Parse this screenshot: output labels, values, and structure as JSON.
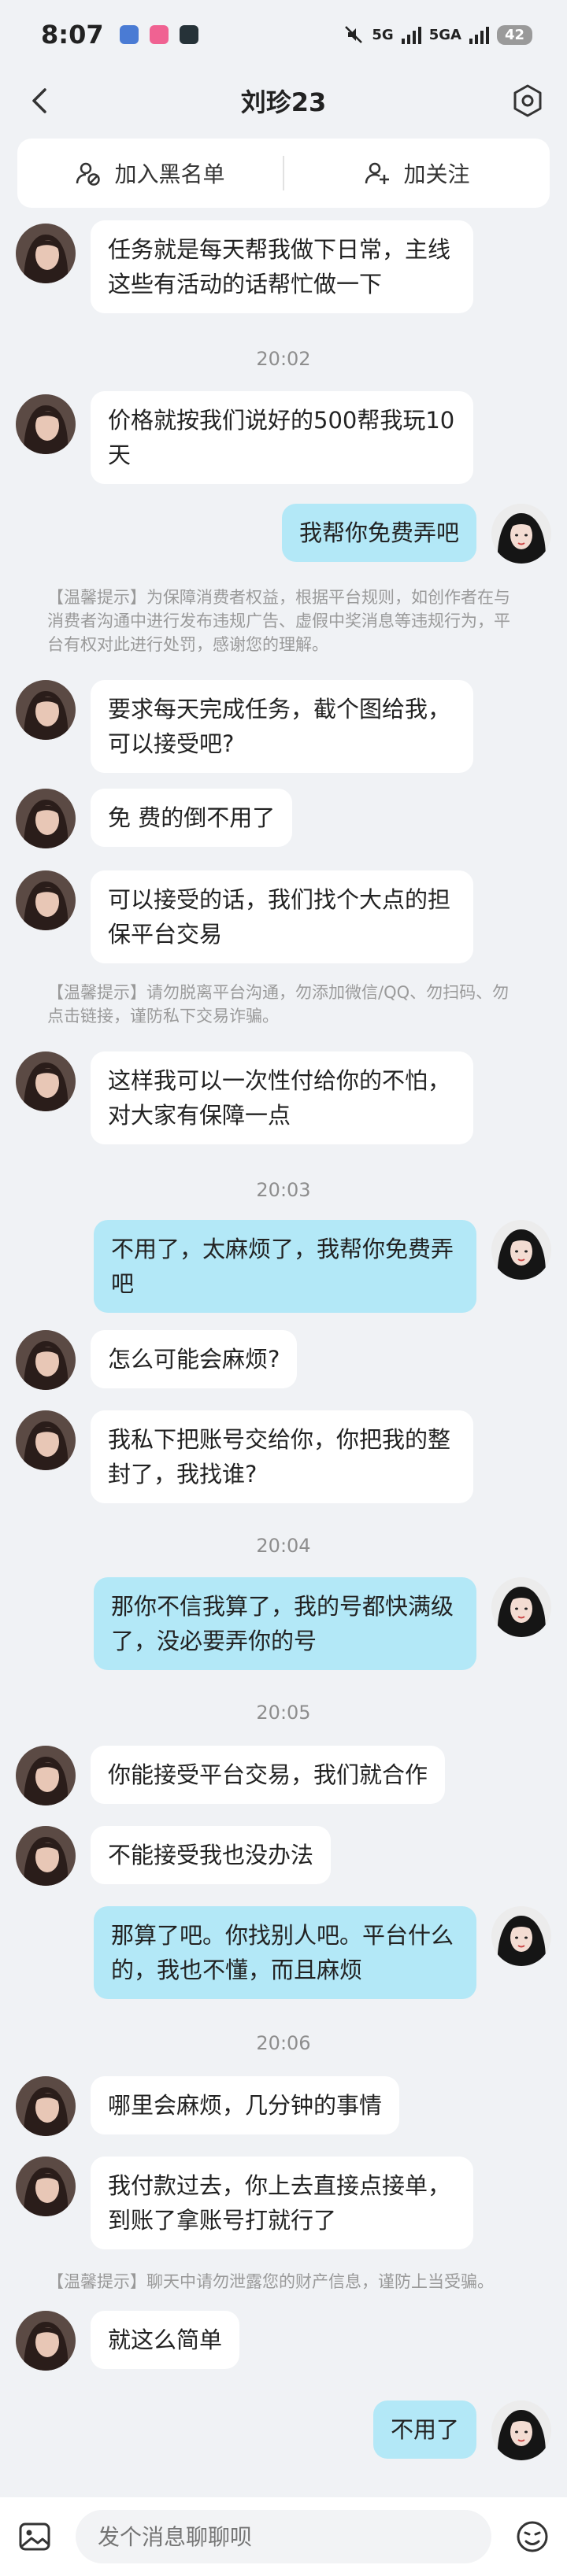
{
  "status": {
    "time": "8:07",
    "network": "5G",
    "network2": "5GA",
    "battery": "42"
  },
  "header": {
    "title": "刘珍23"
  },
  "actions": {
    "blacklist": "加入黑名单",
    "follow": "加关注"
  },
  "messages": [
    {
      "side": "her",
      "text": "任务就是每天帮我做下日常，主线这些有活动的话帮忙做一下"
    },
    {
      "time": "20:02"
    },
    {
      "side": "her",
      "text": "价格就按我们说好的500帮我玩10天"
    },
    {
      "side": "me",
      "text": "我帮你免费弄吧"
    },
    {
      "notice": "【温馨提示】为保障消费者权益，根据平台规则，如创作者在与消费者沟通中进行发布违规广告、虚假中奖消息等违规行为，平台有权对此进行处罚，感谢您的理解。"
    },
    {
      "side": "her",
      "text": "要求每天完成任务，截个图给我，可以接受吧?"
    },
    {
      "side": "her",
      "text": "免 费的倒不用了"
    },
    {
      "side": "her",
      "text": "可以接受的话，我们找个大点的担保平台交易"
    },
    {
      "notice": "【温馨提示】请勿脱离平台沟通，勿添加微信/QQ、勿扫码、勿点击链接，谨防私下交易诈骗。"
    },
    {
      "side": "her",
      "text": "这样我可以一次性付给你的不怕，对大家有保障一点"
    },
    {
      "time": "20:03"
    },
    {
      "side": "me",
      "text": "不用了，太麻烦了，我帮你免费弄吧"
    },
    {
      "side": "her",
      "text": "怎么可能会麻烦?"
    },
    {
      "side": "her",
      "text": "我私下把账号交给你，你把我的整封了，我找谁?"
    },
    {
      "time": "20:04"
    },
    {
      "side": "me",
      "text": "那你不信我算了，我的号都快满级了，没必要弄你的号"
    },
    {
      "time": "20:05"
    },
    {
      "side": "her",
      "text": "你能接受平台交易，我们就合作"
    },
    {
      "side": "her",
      "text": "不能接受我也没办法"
    },
    {
      "side": "me",
      "text": "那算了吧。你找别人吧。平台什么的，我也不懂，而且麻烦"
    },
    {
      "time": "20:06"
    },
    {
      "side": "her",
      "text": "哪里会麻烦，几分钟的事情"
    },
    {
      "side": "her",
      "text": "我付款过去，你上去直接点接单，到账了拿账号打就行了"
    },
    {
      "notice": "【温馨提示】聊天中请勿泄露您的财产信息，谨防上当受骗。"
    },
    {
      "side": "her",
      "text": "就这么简单"
    },
    {
      "side": "me",
      "text": "不用了"
    }
  ],
  "input": {
    "placeholder": "发个消息聊聊呗"
  },
  "icons": {
    "back": "chevron-left-icon",
    "settings": "gear-icon",
    "blacklist": "block-user-icon",
    "follow": "add-user-icon",
    "image": "image-icon",
    "emoji": "emoji-icon"
  },
  "colors": {
    "my_bubble": "#b3e8f7",
    "her_bubble": "#ffffff",
    "background": "#f0f2f5"
  }
}
